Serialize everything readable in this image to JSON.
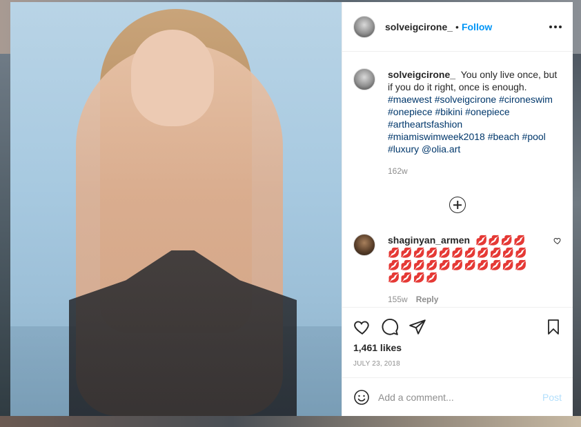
{
  "post": {
    "author": "solveigcirone_",
    "follow_label": "Follow",
    "separator": "•",
    "more_icon": "more-options-icon"
  },
  "caption": {
    "author": "solveigcirone_",
    "text": "You only live once, but if you do it right, once is enough.",
    "hashtags": "#maewest #solveigcirone #cironeswim #onepiece #bikini #onepiece #artheartsfashion #miamiswimweek2018 #beach #pool #luxury @olia.art",
    "time": "162w"
  },
  "load_more_icon": "plus-circle-icon",
  "comments": [
    {
      "author": "shaginyan_armen",
      "text": "💋💋💋💋💋💋💋💋💋💋💋💋💋💋💋💋💋💋💋💋💋💋💋💋💋💋💋💋💋💋",
      "time": "155w",
      "reply_label": "Reply"
    }
  ],
  "actions": {
    "like_icon": "heart-icon",
    "comment_icon": "comment-icon",
    "share_icon": "share-icon",
    "save_icon": "bookmark-icon"
  },
  "likes": "1,461 likes",
  "date": "JULY 23, 2018",
  "add_comment": {
    "placeholder": "Add a comment...",
    "post_label": "Post",
    "emoji_icon": "smiley-icon"
  },
  "colors": {
    "link": "#0095f6",
    "hashtag": "#00376b",
    "muted": "#8e8e8e",
    "post_disabled": "#b2dffc",
    "lips": "#c8102e"
  }
}
